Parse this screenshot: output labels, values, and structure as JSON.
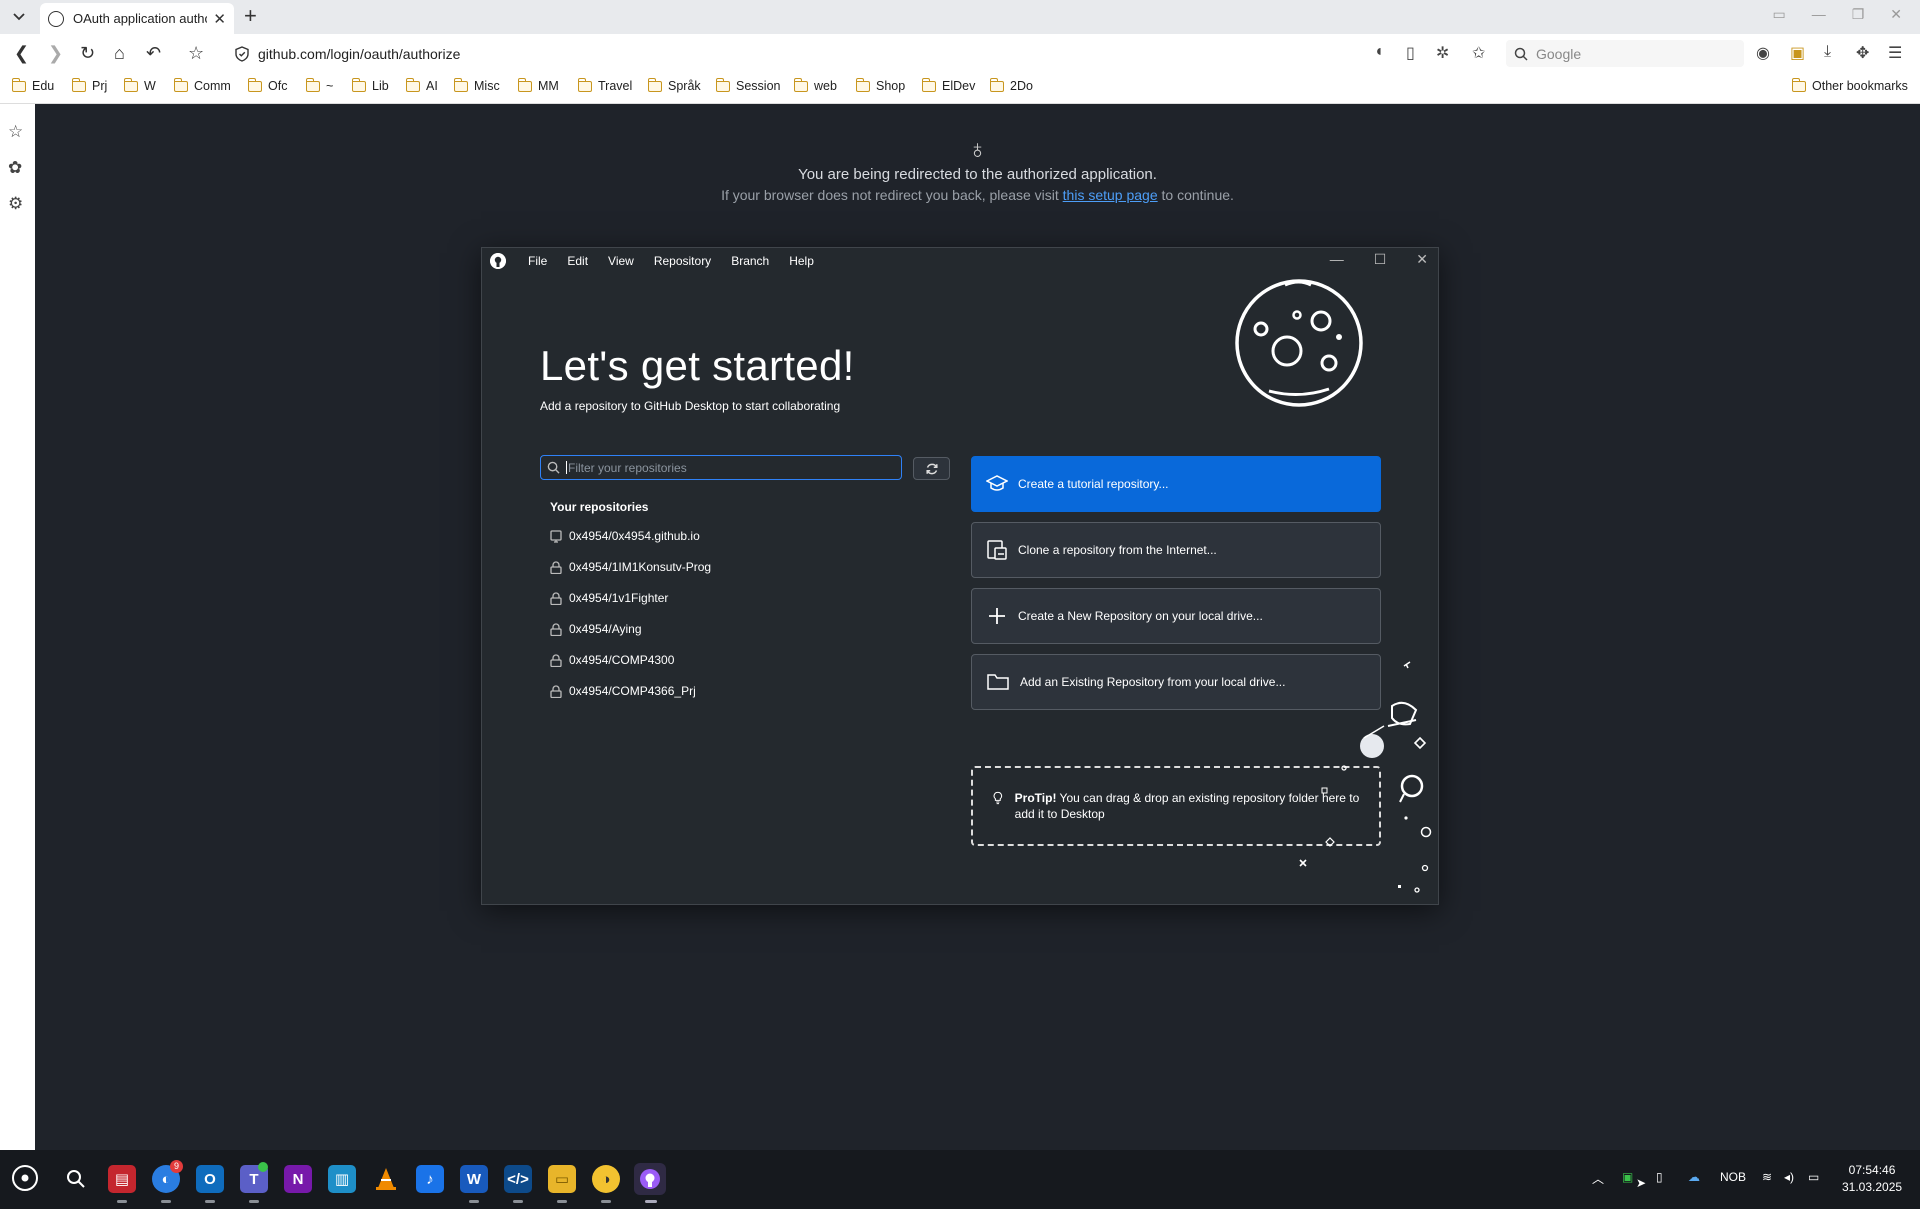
{
  "browser": {
    "tab_title": "OAuth application autho",
    "new_tab": "+",
    "url": "github.com/login/oauth/authorize",
    "search_placeholder": "Google",
    "bookmarks": [
      "Edu",
      "Prj",
      "W",
      "Comm",
      "Ofc",
      "~",
      "Lib",
      "AI",
      "Misc",
      "MM",
      "Travel",
      "Språk",
      "Session",
      "web",
      "Shop",
      "ElDev",
      "2Do"
    ],
    "other_bookmarks": "Other bookmarks"
  },
  "page": {
    "redirect_title": "You are being redirected to the authorized application.",
    "redirect_sub_before": "If your browser does not redirect you back, please visit ",
    "redirect_link": "this setup page",
    "redirect_sub_after": " to continue."
  },
  "desktop": {
    "menu": [
      "File",
      "Edit",
      "View",
      "Repository",
      "Branch",
      "Help"
    ],
    "title": "Let's get started!",
    "subtitle": "Add a repository to GitHub Desktop to start collaborating",
    "filter_placeholder": "Filter your repositories",
    "repos_heading": "Your repositories",
    "repos": [
      {
        "name": "0x4954/0x4954.github.io",
        "icon": "repo-icon"
      },
      {
        "name": "0x4954/1IM1Konsutv-Prog",
        "icon": "lock-icon"
      },
      {
        "name": "0x4954/1v1Fighter",
        "icon": "lock-icon"
      },
      {
        "name": "0x4954/Aying",
        "icon": "lock-icon"
      },
      {
        "name": "0x4954/COMP4300",
        "icon": "lock-icon"
      },
      {
        "name": "0x4954/COMP4366_Prj",
        "icon": "lock-icon"
      }
    ],
    "actions": [
      "Create a tutorial repository...",
      "Clone a repository from the Internet...",
      "Create a New Repository on your local drive...",
      "Add an Existing Repository from your local drive..."
    ],
    "protip_bold": "ProTip!",
    "protip_text": " You can drag & drop an existing repository folder here to add it to Desktop"
  },
  "taskbar": {
    "language": "NOB",
    "time": "07:54:46",
    "date": "31.03.2025",
    "notification_badge": "9"
  },
  "colors": {
    "page_bg": "#1f232a",
    "desktop_bg": "#24292e",
    "primary_button": "#0969da",
    "link": "#4d9ef7"
  }
}
